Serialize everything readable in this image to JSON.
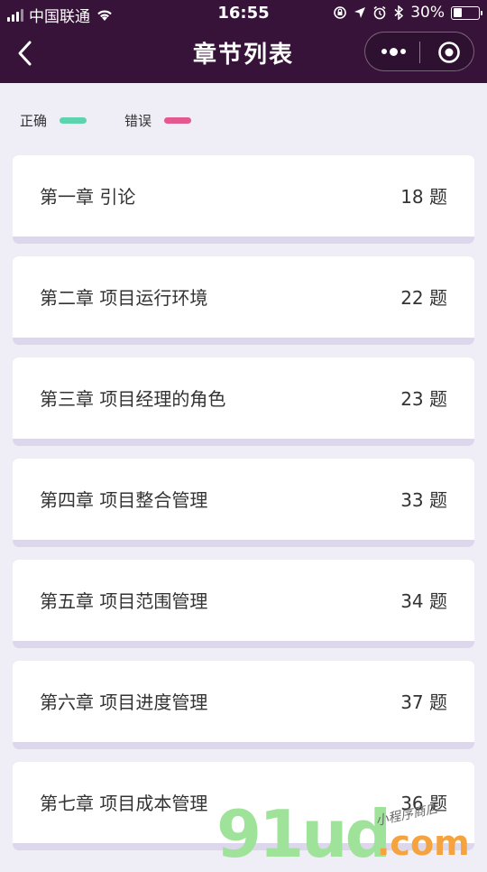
{
  "statusbar": {
    "carrier": "中国联通",
    "time": "16:55",
    "battery": "30%",
    "battery_level": 0.3
  },
  "navbar": {
    "title": "章节列表",
    "back_icon": "chevron-left-icon",
    "more_icon": "more-dots-icon",
    "close_icon": "target-circle-icon"
  },
  "legend": [
    {
      "label": "正确",
      "color": "#5fd3ae"
    },
    {
      "label": "错误",
      "color": "#e2588f"
    }
  ],
  "chapters": [
    {
      "name": "第一章 引论",
      "count": "18 题"
    },
    {
      "name": "第二章 项目运行环境",
      "count": "22 题"
    },
    {
      "name": "第三章 项目经理的角色",
      "count": "23 题"
    },
    {
      "name": "第四章 项目整合管理",
      "count": "33 题"
    },
    {
      "name": "第五章 项目范围管理",
      "count": "34 题"
    },
    {
      "name": "第六章 项目进度管理",
      "count": "37 题"
    },
    {
      "name": "第七章 项目成本管理",
      "count": "36 题"
    }
  ],
  "watermark": {
    "brand": "91ud",
    "domain": ".com",
    "tagline": "小程序商店"
  },
  "colors": {
    "header_bg": "#371339",
    "page_bg": "#efedf5"
  }
}
